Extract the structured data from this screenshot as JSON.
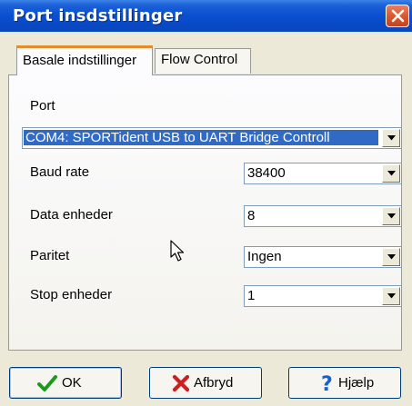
{
  "window": {
    "title": "Port insdstillinger"
  },
  "tabs": [
    {
      "label": "Basale indstillinger",
      "active": true
    },
    {
      "label": "Flow Control",
      "active": false
    }
  ],
  "form": {
    "port": {
      "label": "Port",
      "value": "COM4:  SPORTident USB to UART Bridge Controll"
    },
    "baud": {
      "label": "Baud rate",
      "value": "38400"
    },
    "data_bits": {
      "label": "Data enheder",
      "value": "8"
    },
    "parity": {
      "label": "Paritet",
      "value": "Ingen"
    },
    "stop_bits": {
      "label": "Stop enheder",
      "value": "1"
    }
  },
  "buttons": {
    "ok": "OK",
    "cancel": "Afbryd",
    "help": "Hjælp"
  },
  "colors": {
    "titlebar": "#0a4fd0",
    "selection": "#316ac5",
    "tab_highlight": "#e68b2c"
  }
}
